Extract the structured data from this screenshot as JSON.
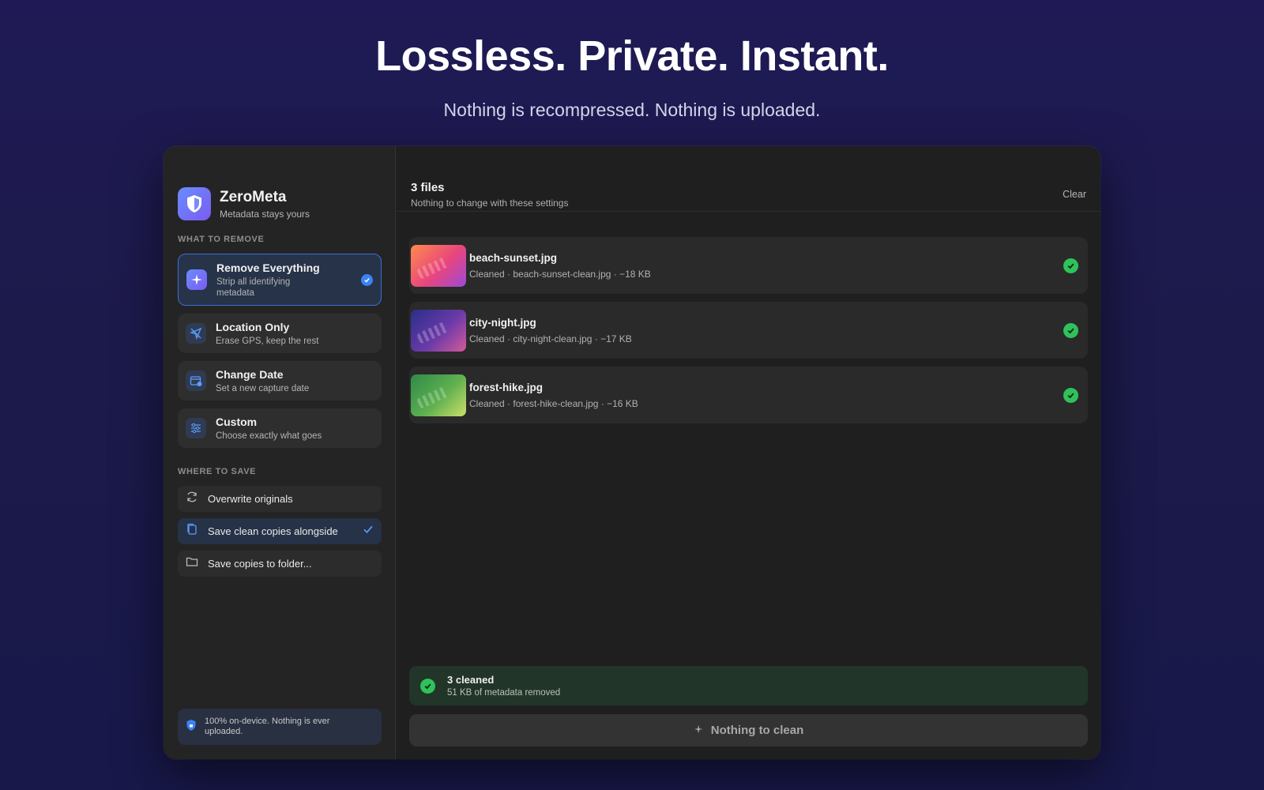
{
  "hero": {
    "title": "Lossless. Private. Instant.",
    "subtitle": "Nothing is recompressed. Nothing is uploaded."
  },
  "app": {
    "name": "ZeroMeta",
    "tagline": "Metadata stays yours"
  },
  "sidebar": {
    "remove_section_label": "WHAT TO REMOVE",
    "remove_options": [
      {
        "title": "Remove Everything",
        "desc": "Strip all identifying metadata",
        "icon": "sparkles-icon",
        "selected": true
      },
      {
        "title": "Location Only",
        "desc": "Erase GPS, keep the rest",
        "icon": "location-off-icon",
        "selected": false
      },
      {
        "title": "Change Date",
        "desc": "Set a new capture date",
        "icon": "calendar-icon",
        "selected": false
      },
      {
        "title": "Custom",
        "desc": "Choose exactly what goes",
        "icon": "sliders-icon",
        "selected": false
      }
    ],
    "save_section_label": "WHERE TO SAVE",
    "save_options": [
      {
        "label": "Overwrite originals",
        "icon": "refresh-icon",
        "selected": false
      },
      {
        "label": "Save clean copies alongside",
        "icon": "copy-icon",
        "selected": true
      },
      {
        "label": "Save copies to folder...",
        "icon": "folder-icon",
        "selected": false
      }
    ],
    "privacy_note": "100% on-device. Nothing is ever uploaded."
  },
  "main": {
    "files_count": "3 files",
    "files_sub": "Nothing to change with these settings",
    "clear_label": "Clear",
    "files": [
      {
        "name": "beach-sunset.jpg",
        "meta": "Cleaned · beach-sunset-clean.jpg · −18 KB",
        "thumb_colors": [
          "#ff8a4c",
          "#e8457d",
          "#9a4bd8"
        ]
      },
      {
        "name": "city-night.jpg",
        "meta": "Cleaned · city-night-clean.jpg · −17 KB",
        "thumb_colors": [
          "#2a2f8a",
          "#6a3aa8",
          "#d65a9a"
        ]
      },
      {
        "name": "forest-hike.jpg",
        "meta": "Cleaned · forest-hike-clean.jpg · −16 KB",
        "thumb_colors": [
          "#2f8a4a",
          "#5fb04f",
          "#cde06a"
        ]
      }
    ],
    "summary_title": "3 cleaned",
    "summary_sub": "51 KB of metadata removed",
    "clean_button": "Nothing to clean"
  },
  "colors": {
    "accent": "#3c82f6",
    "success": "#2fc25b",
    "brand_gradient_start": "#6a8cff",
    "brand_gradient_end": "#7a5cf0"
  }
}
